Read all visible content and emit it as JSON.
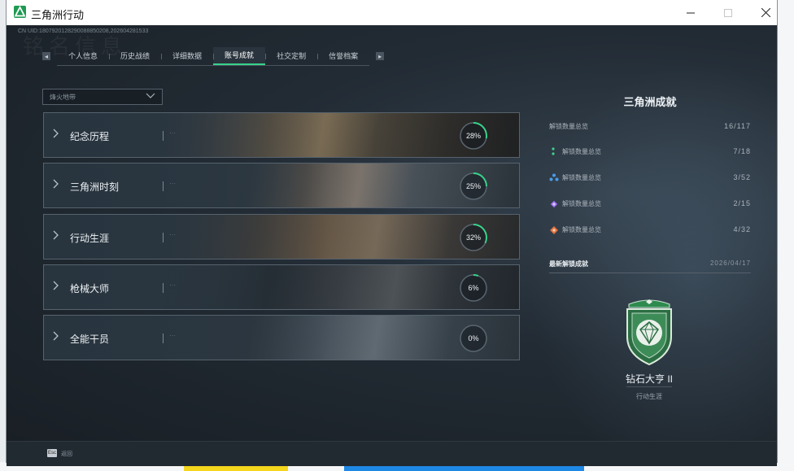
{
  "window": {
    "title": "三角洲行动"
  },
  "header": {
    "uid": "CN UID:1807920128290088850208,202604281533",
    "watermark": "铭名信息"
  },
  "nav": {
    "left_arrow": "◂",
    "right_arrow": "▸",
    "tabs": [
      {
        "label": "个人信息"
      },
      {
        "label": "历史战绩"
      },
      {
        "label": "详细数据"
      },
      {
        "label": "账号成就",
        "active": true
      },
      {
        "label": "社交定制"
      },
      {
        "label": "信誉档案"
      }
    ]
  },
  "filter": {
    "value": "烽火地带"
  },
  "categories": [
    {
      "label": "纪念历程",
      "percent": 28,
      "percent_text": "28%"
    },
    {
      "label": "三角洲时刻",
      "percent": 25,
      "percent_text": "25%"
    },
    {
      "label": "行动生涯",
      "percent": 32,
      "percent_text": "32%"
    },
    {
      "label": "枪械大师",
      "percent": 6,
      "percent_text": "6%"
    },
    {
      "label": "全能干员",
      "percent": 0,
      "percent_text": "0%"
    }
  ],
  "summary": {
    "title": "三角洲成就",
    "total": {
      "label": "解锁数量总览",
      "value": "16/117"
    },
    "rows": [
      {
        "icon": "green-rank-icon",
        "color": "#3fd18e",
        "label": "解锁数量总览",
        "value": "7/18"
      },
      {
        "icon": "blue-rank-icon",
        "color": "#4a9be8",
        "label": "解锁数量总览",
        "value": "3/52"
      },
      {
        "icon": "purple-rank-icon",
        "color": "#9b6cf0",
        "label": "解锁数量总览",
        "value": "2/15"
      },
      {
        "icon": "orange-rank-icon",
        "color": "#e2733f",
        "label": "解锁数量总览",
        "value": "4/32"
      }
    ]
  },
  "latest": {
    "label": "最新解锁成就",
    "date": "2026/04/17",
    "badge_name": "钻石大亨 II",
    "badge_category": "行动生涯"
  },
  "footer": {
    "key": "Esc",
    "label": "返回"
  },
  "colors": {
    "accent": "#39d38a",
    "ring_track": "#5a656f"
  }
}
